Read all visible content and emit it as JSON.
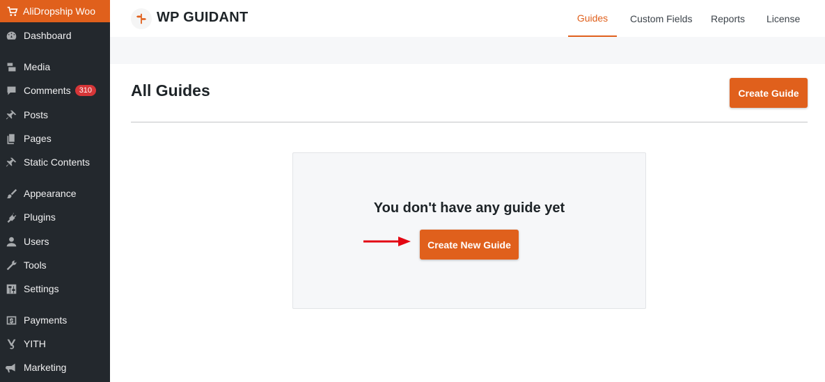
{
  "sidebar": {
    "top_item": "AliDropship Woo",
    "items": [
      {
        "label": "Dashboard",
        "icon": "dashboard-icon"
      },
      {
        "label": "Media",
        "icon": "media-icon"
      },
      {
        "label": "Comments",
        "icon": "comments-icon",
        "badge": "310"
      },
      {
        "label": "Posts",
        "icon": "pin-icon"
      },
      {
        "label": "Pages",
        "icon": "pages-icon"
      },
      {
        "label": "Static Contents",
        "icon": "pin-icon"
      },
      {
        "label": "Appearance",
        "icon": "brush-icon"
      },
      {
        "label": "Plugins",
        "icon": "plugin-icon"
      },
      {
        "label": "Users",
        "icon": "users-icon"
      },
      {
        "label": "Tools",
        "icon": "wrench-icon"
      },
      {
        "label": "Settings",
        "icon": "settings-icon"
      },
      {
        "label": "Payments",
        "icon": "dollar-icon"
      },
      {
        "label": "YITH",
        "icon": "yith-icon"
      },
      {
        "label": "Marketing",
        "icon": "megaphone-icon"
      }
    ]
  },
  "header": {
    "brand": "WP GUIDANT",
    "nav": [
      "Guides",
      "Custom Fields",
      "Reports",
      "License"
    ],
    "active_nav": "Guides"
  },
  "main": {
    "title": "All Guides",
    "create_button": "Create Guide",
    "empty_message": "You don't have any guide yet",
    "create_new_button": "Create New Guide"
  },
  "colors": {
    "accent": "#e0601c",
    "sidebar_bg": "#23282d",
    "badge": "#d63638",
    "arrow": "#e30613"
  }
}
